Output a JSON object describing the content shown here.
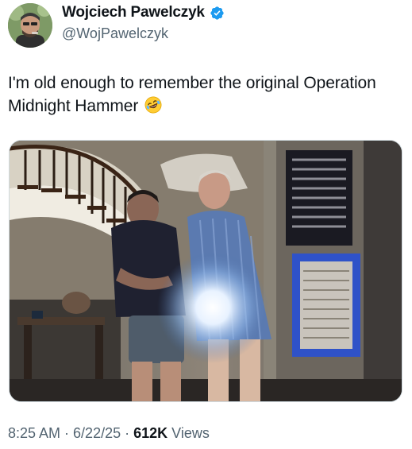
{
  "author": {
    "display_name": "Wojciech Pawelczyk",
    "handle": "@WojPawelczyk",
    "verified_icon": "verified-badge-icon",
    "avatar_icon": "user-avatar"
  },
  "tweet": {
    "text": "I'm old enough to remember the original Operation Midnight Hammer",
    "emoji": "rolling-on-floor-laughing-emoji"
  },
  "media": {
    "kind": "bodycam-photo"
  },
  "meta": {
    "time": "8:25 AM",
    "separator": "·",
    "date": "6/22/25",
    "views_count": "612K",
    "views_label": "Views"
  },
  "colors": {
    "text": "#0f1419",
    "secondary": "#536471",
    "verified": "#1d9bf0"
  }
}
